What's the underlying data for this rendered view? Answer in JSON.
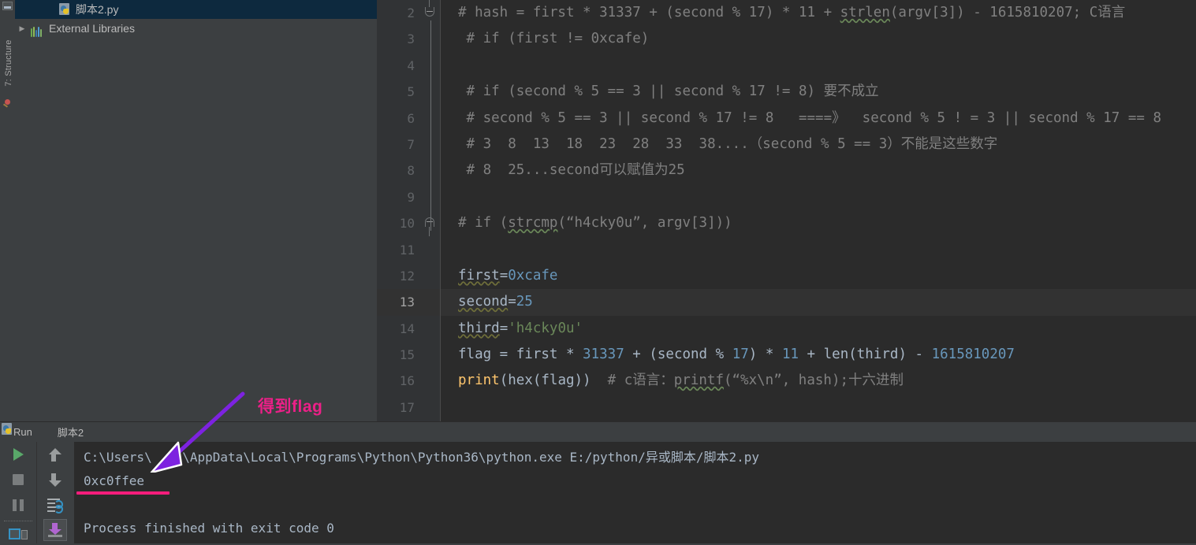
{
  "tool_strip": {
    "label": "7: Structure",
    "icons": [
      "window-icon",
      "bulb-icon"
    ]
  },
  "project_tree": {
    "items": [
      {
        "label": "脚本2.py",
        "icon": "python-file-icon",
        "selected": true,
        "has_arrow": false
      },
      {
        "label": "External Libraries",
        "icon": "library-icon",
        "selected": false,
        "has_arrow": true,
        "arrow": "▶"
      }
    ]
  },
  "editor": {
    "lines": [
      {
        "number": "2",
        "fold": "start",
        "current": false,
        "segments": [
          {
            "text": "# hash = first * 31337 + (second % 17) * 11 + ",
            "cls": "cm"
          },
          {
            "text": "strlen",
            "cls": "cm squig"
          },
          {
            "text": "(argv[3]) - 1615810207; C语言",
            "cls": "cm"
          }
        ]
      },
      {
        "number": "3",
        "fold": "",
        "current": false,
        "segments": [
          {
            "text": " # if (first != 0xcafe)",
            "cls": "cm"
          }
        ]
      },
      {
        "number": "4",
        "fold": "",
        "current": false,
        "segments": [
          {
            "text": "",
            "cls": "cm"
          }
        ]
      },
      {
        "number": "5",
        "fold": "",
        "current": false,
        "segments": [
          {
            "text": " # if (second % 5 == 3 || second % 17 != 8) 要不成立",
            "cls": "cm"
          }
        ]
      },
      {
        "number": "6",
        "fold": "",
        "current": false,
        "segments": [
          {
            "text": " # second % 5 == 3 || second % 17 != 8   ====》  second % 5 ! = 3 || second % 17 == 8",
            "cls": "cm"
          }
        ]
      },
      {
        "number": "7",
        "fold": "",
        "current": false,
        "segments": [
          {
            "text": " # 3  8  13  18  23  28  33  38....（second % 5 == 3）不能是这些数字",
            "cls": "cm"
          }
        ]
      },
      {
        "number": "8",
        "fold": "",
        "current": false,
        "segments": [
          {
            "text": " # 8  25...second可以赋值为25",
            "cls": "cm"
          }
        ]
      },
      {
        "number": "9",
        "fold": "",
        "current": false,
        "segments": [
          {
            "text": "",
            "cls": "cm"
          }
        ]
      },
      {
        "number": "10",
        "fold": "end",
        "current": false,
        "segments": [
          {
            "text": "# if (",
            "cls": "cm"
          },
          {
            "text": "strcmp",
            "cls": "cm squig"
          },
          {
            "text": "(“h4cky0u”, argv[3]))",
            "cls": "cm"
          }
        ]
      },
      {
        "number": "11",
        "fold": "",
        "current": false,
        "segments": [
          {
            "text": "",
            "cls": "cm"
          }
        ]
      },
      {
        "number": "12",
        "fold": "",
        "current": false,
        "segments": [
          {
            "text": "first",
            "cls": "ident squig-w"
          },
          {
            "text": "=",
            "cls": "ident"
          },
          {
            "text": "0xcafe",
            "cls": "num"
          }
        ]
      },
      {
        "number": "13",
        "fold": "",
        "current": true,
        "segments": [
          {
            "text": "second",
            "cls": "ident squig-w"
          },
          {
            "text": "=",
            "cls": "ident"
          },
          {
            "text": "25",
            "cls": "num"
          }
        ]
      },
      {
        "number": "14",
        "fold": "",
        "current": false,
        "segments": [
          {
            "text": "third",
            "cls": "ident squig-w"
          },
          {
            "text": "=",
            "cls": "ident"
          },
          {
            "text": "'h4cky0u'",
            "cls": "str"
          }
        ]
      },
      {
        "number": "15",
        "fold": "",
        "current": false,
        "segments": [
          {
            "text": "flag = first * ",
            "cls": "ident"
          },
          {
            "text": "31337",
            "cls": "num"
          },
          {
            "text": " + (second % ",
            "cls": "ident"
          },
          {
            "text": "17",
            "cls": "num"
          },
          {
            "text": ") * ",
            "cls": "ident"
          },
          {
            "text": "11",
            "cls": "num"
          },
          {
            "text": " + len(third) - ",
            "cls": "ident"
          },
          {
            "text": "1615810207",
            "cls": "num"
          }
        ]
      },
      {
        "number": "16",
        "fold": "",
        "current": false,
        "segments": [
          {
            "text": "print",
            "cls": "fn"
          },
          {
            "text": "(hex(flag))  ",
            "cls": "ident"
          },
          {
            "text": "# c语言：",
            "cls": "cm"
          },
          {
            "text": "printf",
            "cls": "cm squig"
          },
          {
            "text": "(“%x\\n”, hash);十六进制",
            "cls": "cm"
          }
        ]
      },
      {
        "number": "17",
        "fold": "",
        "current": false,
        "segments": [
          {
            "text": "",
            "cls": "cm"
          }
        ]
      }
    ]
  },
  "run_window": {
    "title": "Run",
    "tab_label": "脚本2",
    "tab_icon": "python-icon",
    "toolbar_left": [
      {
        "name": "run-button",
        "icon": "play-icon"
      },
      {
        "name": "stop-button",
        "icon": "stop-icon"
      },
      {
        "name": "pause-button",
        "icon": "pause-icon"
      },
      {
        "name": "show-console-button",
        "icon": "console-icon"
      }
    ],
    "toolbar_right": [
      {
        "name": "up-button",
        "icon": "arrow-up-icon"
      },
      {
        "name": "down-button",
        "icon": "arrow-down-icon"
      },
      {
        "name": "soft-wrap-button",
        "icon": "soft-wrap-icon"
      },
      {
        "name": "scroll-to-end-button",
        "icon": "scroll-to-end-icon"
      }
    ],
    "console": [
      "C:\\Users\\    \\AppData\\Local\\Programs\\Python\\Python36\\python.exe E:/python/异或脚本/脚本2.py",
      "0xc0ffee",
      "",
      "Process finished with exit code 0"
    ]
  },
  "annotations": {
    "flag_note": "得到flag",
    "note_color": "#ec2088",
    "underline_color": "#f51d7c",
    "arrow_color": "#8a2be2"
  }
}
